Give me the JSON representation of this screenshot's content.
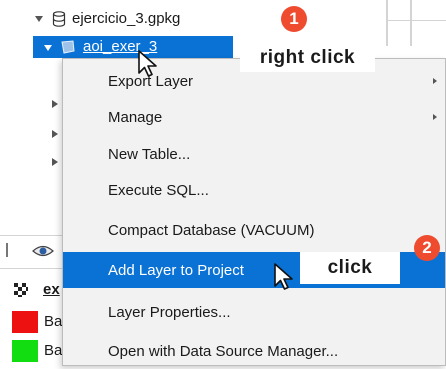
{
  "tree": {
    "root_label": "ejercicio_3.gpkg",
    "selected_label": "aoi_exer_3"
  },
  "legend": {
    "header_label": "ex",
    "rows": [
      {
        "label": "Ba",
        "color": "#ee1111"
      },
      {
        "label": "Ba",
        "color": "#11dd11"
      }
    ]
  },
  "context_menu": {
    "items": [
      {
        "label": "Export Layer",
        "submenu": true
      },
      {
        "label": "Manage",
        "submenu": true
      },
      {
        "label": "New Table...",
        "submenu": false
      },
      {
        "label": "Execute SQL...",
        "submenu": false
      },
      {
        "label": "Compact Database (VACUUM)",
        "submenu": false
      },
      {
        "label": "Add Layer to Project",
        "submenu": false,
        "highlighted": true
      },
      {
        "label": "Layer Properties...",
        "submenu": false
      },
      {
        "label": "Open with Data Source Manager...",
        "submenu": false
      }
    ]
  },
  "annotations": {
    "step1_number": "1",
    "step1_text": "right click",
    "step2_number": "2",
    "step2_text": "click",
    "badge_color": "#ef4b2f"
  },
  "colors": {
    "selection": "#0a72d4",
    "menu_background": "#f2f2f2"
  }
}
